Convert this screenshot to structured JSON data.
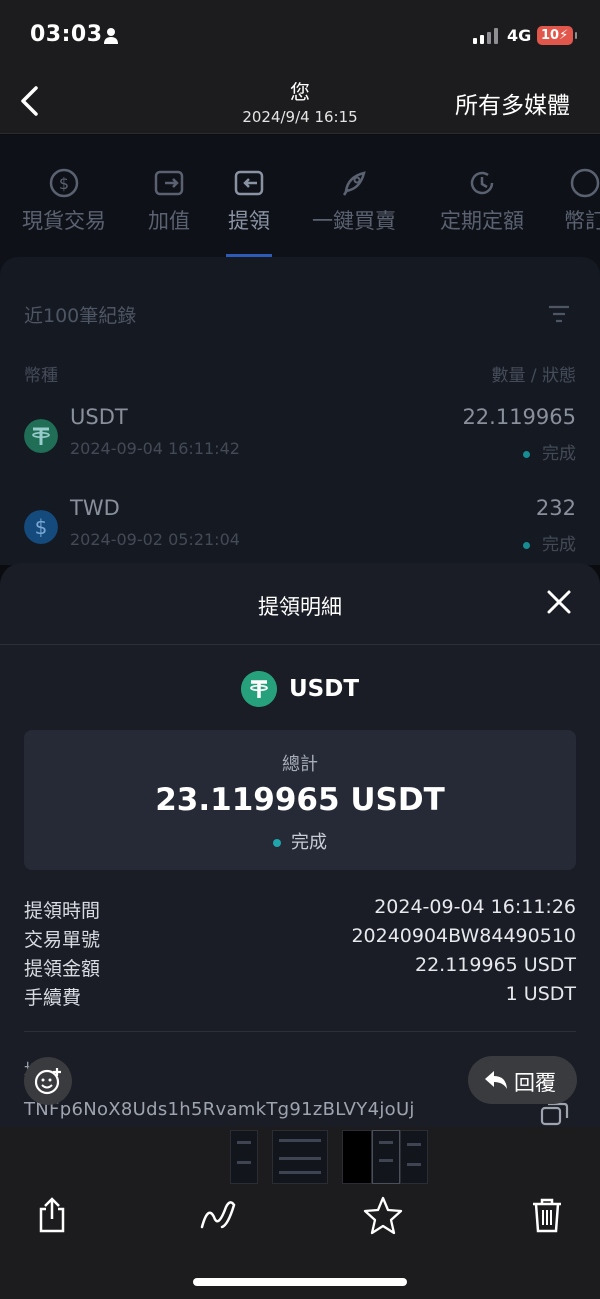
{
  "status_bar": {
    "time": "03:03",
    "network": "4G",
    "battery": "10"
  },
  "viewer": {
    "title": "您",
    "date": "2024/9/4 16:15",
    "all_media": "所有多媒體"
  },
  "tabs": [
    {
      "label": "現貨交易",
      "icon": "coin-dollar-icon"
    },
    {
      "label": "加值",
      "icon": "wallet-in-icon"
    },
    {
      "label": "提領",
      "icon": "wallet-out-icon",
      "active": true
    },
    {
      "label": "一鍵買賣",
      "icon": "rocket-icon"
    },
    {
      "label": "定期定額",
      "icon": "clock-dollar-icon"
    },
    {
      "label": "幣訂",
      "icon": "coin-icon"
    }
  ],
  "records": {
    "title": "近100筆紀錄",
    "col_left": "幣種",
    "col_right": "數量 / 狀態",
    "rows": [
      {
        "symbol": "USDT",
        "datetime": "2024-09-04 16:11:42",
        "amount": "22.119965",
        "status": "完成",
        "color": "#26a17b"
      },
      {
        "symbol": "TWD",
        "datetime": "2024-09-02 05:21:04",
        "amount": "232",
        "status": "完成",
        "color": "#1a5fa0"
      }
    ]
  },
  "sheet": {
    "title": "提領明細",
    "coin": "USDT",
    "total_label": "總計",
    "total_value": "23.119965 USDT",
    "status": "完成",
    "details": [
      {
        "key": "提領時間",
        "value": "2024-09-04 16:11:26"
      },
      {
        "key": "交易單號",
        "value": "20240904BW84490510"
      },
      {
        "key": "提領金額",
        "value": "22.119965 USDT"
      },
      {
        "key": "手續費",
        "value": "1 USDT"
      }
    ],
    "address_label": "地址",
    "address": "TNFp6NoX8Uds1h5RvamkTg91zBLVY4joUj"
  },
  "reply_label": "回覆",
  "colors": {
    "accent": "#26a17b",
    "status_dot": "#1fa5ac",
    "sheet_bg": "#1a1d26"
  }
}
